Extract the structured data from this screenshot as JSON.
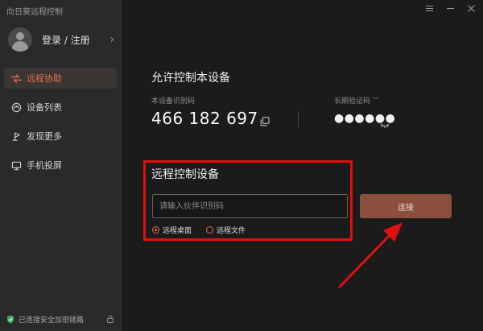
{
  "app": {
    "title": "向日葵远程控制"
  },
  "user": {
    "label": "登录 / 注册"
  },
  "sidebar": {
    "items": [
      {
        "label": "远程协助",
        "icon": "remote-assist-icon",
        "active": true
      },
      {
        "label": "设备列表",
        "icon": "device-list-icon",
        "active": false
      },
      {
        "label": "发现更多",
        "icon": "discover-icon",
        "active": false
      },
      {
        "label": "手机投屏",
        "icon": "screen-cast-icon",
        "active": false
      }
    ],
    "footer": {
      "text": "已连接安全加密链路"
    }
  },
  "allow": {
    "title": "允许控制本设备",
    "device_id_label": "本设备识别码",
    "device_id": "466 182 697",
    "password_label": "长期验证码",
    "password_mask": "●●●●●●"
  },
  "remote": {
    "title": "远程控制设备",
    "input_placeholder": "请输入伙伴识别码",
    "connect_label": "连接",
    "options": [
      {
        "label": "远程桌面",
        "checked": true
      },
      {
        "label": "远程文件",
        "checked": false
      }
    ]
  },
  "colors": {
    "accent": "#e26d4b",
    "connect_bg": "#8b4f3e",
    "highlight": "#e11010",
    "sidebar_bg": "#2a2a2a",
    "main_bg": "#1b1b1b"
  }
}
